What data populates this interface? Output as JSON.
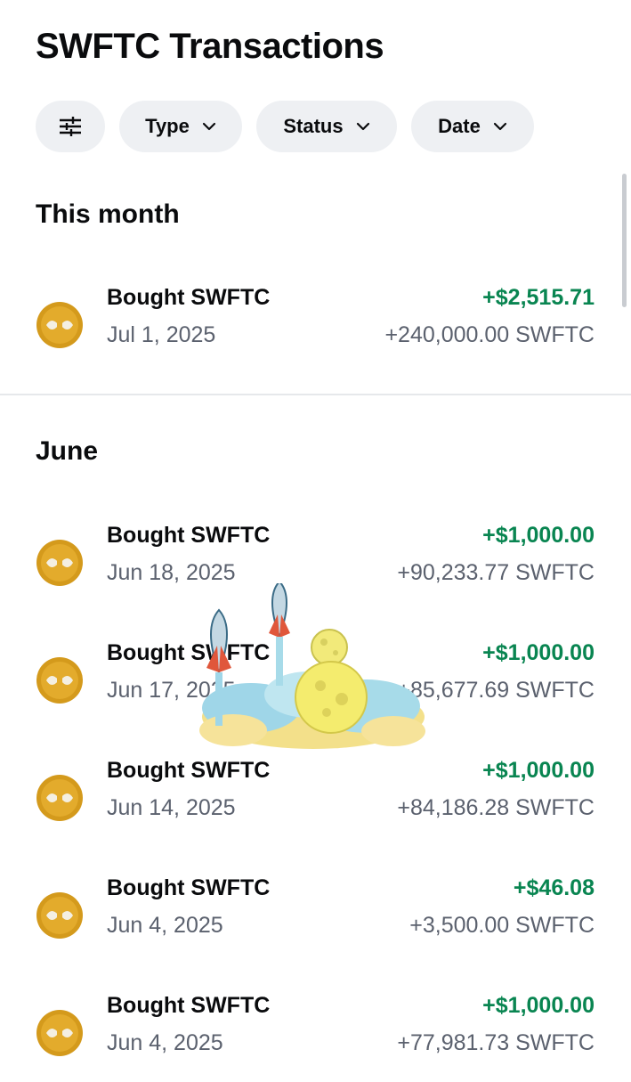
{
  "header": {
    "title": "SWFTC Transactions"
  },
  "filters": {
    "icon": "sliders-icon",
    "type_label": "Type",
    "status_label": "Status",
    "date_label": "Date"
  },
  "sections": [
    {
      "heading": "This month",
      "transactions": [
        {
          "title": "Bought SWFTC",
          "date": "Jul 1, 2025",
          "usd": "+$2,515.71",
          "amount": "+240,000.00 SWFTC"
        }
      ]
    },
    {
      "heading": "June",
      "transactions": [
        {
          "title": "Bought SWFTC",
          "date": "Jun 18, 2025",
          "usd": "+$1,000.00",
          "amount": "+90,233.77 SWFTC"
        },
        {
          "title": "Bought SWFTC",
          "date": "Jun 17, 2025",
          "usd": "+$1,000.00",
          "amount": "+85,677.69 SWFTC"
        },
        {
          "title": "Bought SWFTC",
          "date": "Jun 14, 2025",
          "usd": "+$1,000.00",
          "amount": "+84,186.28 SWFTC"
        },
        {
          "title": "Bought SWFTC",
          "date": "Jun 4, 2025",
          "usd": "+$46.08",
          "amount": "+3,500.00 SWFTC"
        },
        {
          "title": "Bought SWFTC",
          "date": "Jun 4, 2025",
          "usd": "+$1,000.00",
          "amount": "+77,981.73 SWFTC"
        }
      ]
    }
  ],
  "colors": {
    "positive": "#098551",
    "secondary_text": "#5b616e",
    "chip_background": "#eef0f3",
    "coin": "#d49a1c"
  },
  "overlay": {
    "icon": "rocket-moon-sticker"
  }
}
